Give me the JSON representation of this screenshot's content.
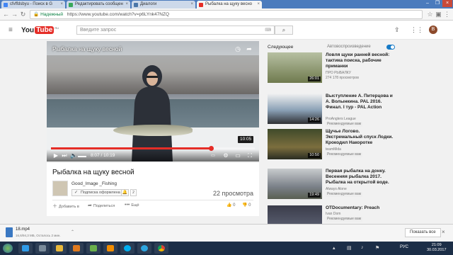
{
  "browser": {
    "tabs": [
      {
        "label": "cfvffdsbyu - Поиск в G",
        "icon_color": "#4285f4",
        "active": false
      },
      {
        "label": "Редактировать сообщен",
        "icon_color": "#39a85a",
        "active": false
      },
      {
        "label": "Диалоги",
        "icon_color": "#4a76a8",
        "active": false
      },
      {
        "label": "Рыбалка на щуку весно",
        "icon_color": "#e52d27",
        "active": true
      }
    ],
    "secure_label": "Надежный",
    "url": "https://www.youtube.com/watch?v=p6LYnk47NZQ"
  },
  "youtube": {
    "logo_text": "You",
    "logo_tube": "Tube",
    "logo_region": "RU",
    "search_placeholder": "Введите запрос",
    "avatar_letter": "В"
  },
  "video": {
    "overlay_title": "Рыбалка на щуку весной",
    "tooltip_time": "10:05",
    "current_time": "8:07",
    "duration": "10:19",
    "progress": 0.786,
    "title": "Рыбалка на щуку весной",
    "channel": "Good_Image _Fishing",
    "subscribe_label": "Подписка оформлена",
    "subscriber_count": "2",
    "views": "22 просмотра",
    "add_label": "Добавить в",
    "share_label": "Поделиться",
    "more_label": "Ещё",
    "likes": "0",
    "dislikes": "0"
  },
  "sidebar": {
    "next_label": "Следующее",
    "autoplay_label": "Автовоспроизведение",
    "items": [
      {
        "title": "Ловля щуки ранней весной: тактика поиска, рабочие приманки",
        "channel": "ПРО РЫБАЛКУ",
        "views": "274 178 просмотров",
        "badge": "",
        "duration": "26:01"
      },
      {
        "title": "Выступление А. Питерцова и А. Волынкина. PAL 2016. Финал. I тур - PAL Action",
        "channel": "ProAnglers League",
        "views": "",
        "badge": "Рекомендуемые вам",
        "duration": "14:26"
      },
      {
        "title": "Щучье Логово. Экстремальный спуск Лодки. Крокодил Накоротке",
        "channel": "teamMida",
        "views": "",
        "badge": "Рекомендуемые вам",
        "duration": "10:50"
      },
      {
        "title": "Первая рыбалка на донку. Весенняя рыбалка 2017. Рыбалка на открытой воде.",
        "channel": "Always Alone",
        "views": "",
        "badge": "Рекомендуемые вам",
        "duration": "19:49"
      },
      {
        "title": "OTDocumentary: Preach",
        "channel": "Ivan Dom",
        "views": "",
        "badge": "Рекомендуемые вам",
        "duration": ""
      }
    ]
  },
  "downloads": {
    "file_name": "18.mp4",
    "status": "16,6/94,3 МБ, Осталось 2 мин.",
    "show_all": "Показать все"
  },
  "taskbar": {
    "lang": "РУС",
    "time": "21:09",
    "date": "30.03.2017"
  }
}
